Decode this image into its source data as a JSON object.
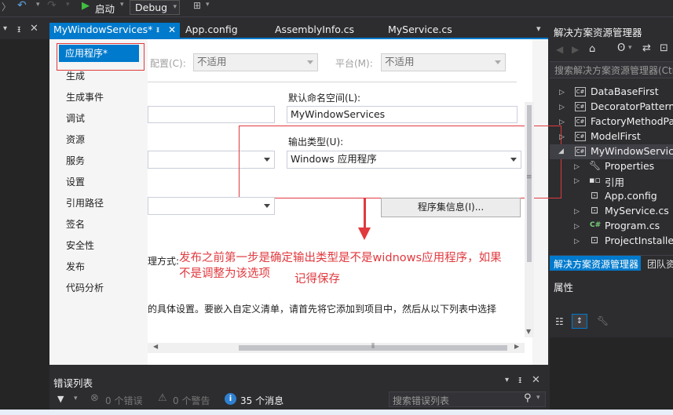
{
  "toolbar": {
    "start_label": "启动",
    "config_value": "Debug"
  },
  "tabs": [
    {
      "label": "MyWindowServices*",
      "active": true
    },
    {
      "label": "App.config"
    },
    {
      "label": "AssemblyInfo.cs"
    },
    {
      "label": "MyService.cs"
    }
  ],
  "nav": {
    "selected": "应用程序*",
    "items": [
      "生成",
      "生成事件",
      "调试",
      "资源",
      "服务",
      "设置",
      "引用路径",
      "签名",
      "安全性",
      "发布",
      "代码分析"
    ]
  },
  "form": {
    "config_label": "配置(C):",
    "config_value": "不适用",
    "platform_label": "平台(M):",
    "platform_value": "不适用",
    "namespace_label": "默认命名空间(L):",
    "namespace_value": "MyWindowServices",
    "output_type_label": "输出类型(U):",
    "output_type_value": "Windows 应用程序",
    "assembly_info_button": "程序集信息(I)...",
    "manage_label": "理方式:",
    "manifest_text": "的具体设置。要嵌入自定义清单，请首先将它添加到项目中，然后从以下列表中选择"
  },
  "annotation": {
    "line1": "发布之前第一步是确定输出类型是不是widnows应用程序，如果",
    "line2": "不是调整为该选项",
    "line3": "记得保存"
  },
  "solution": {
    "title": "解决方案资源管理器",
    "search_placeholder": "搜索解决方案资源管理器(Ctr",
    "items": [
      {
        "label": "DataBaseFirst",
        "type": "project"
      },
      {
        "label": "DecoratorPattern",
        "type": "project"
      },
      {
        "label": "FactoryMethodPat",
        "type": "project"
      },
      {
        "label": "ModelFirst",
        "type": "project"
      },
      {
        "label": "MyWindowService",
        "type": "project"
      },
      {
        "label": "Properties",
        "type": "folder"
      },
      {
        "label": "引用",
        "type": "refs"
      },
      {
        "label": "App.config",
        "type": "file"
      },
      {
        "label": "MyService.cs",
        "type": "file"
      },
      {
        "label": "Program.cs",
        "type": "file"
      },
      {
        "label": "ProjectInstaller",
        "type": "file"
      }
    ],
    "bottom_tab_active": "解决方案资源管理器",
    "bottom_tab_other": "团队资",
    "properties_title": "属性"
  },
  "errors": {
    "title": "错误列表",
    "errors_count": "0 个错误",
    "warnings_count": "0 个警告",
    "messages_count": "35 个消息",
    "search_placeholder": "搜索错误列表"
  },
  "colors": {
    "accent": "#007acc",
    "annotation": "#e0393e"
  }
}
